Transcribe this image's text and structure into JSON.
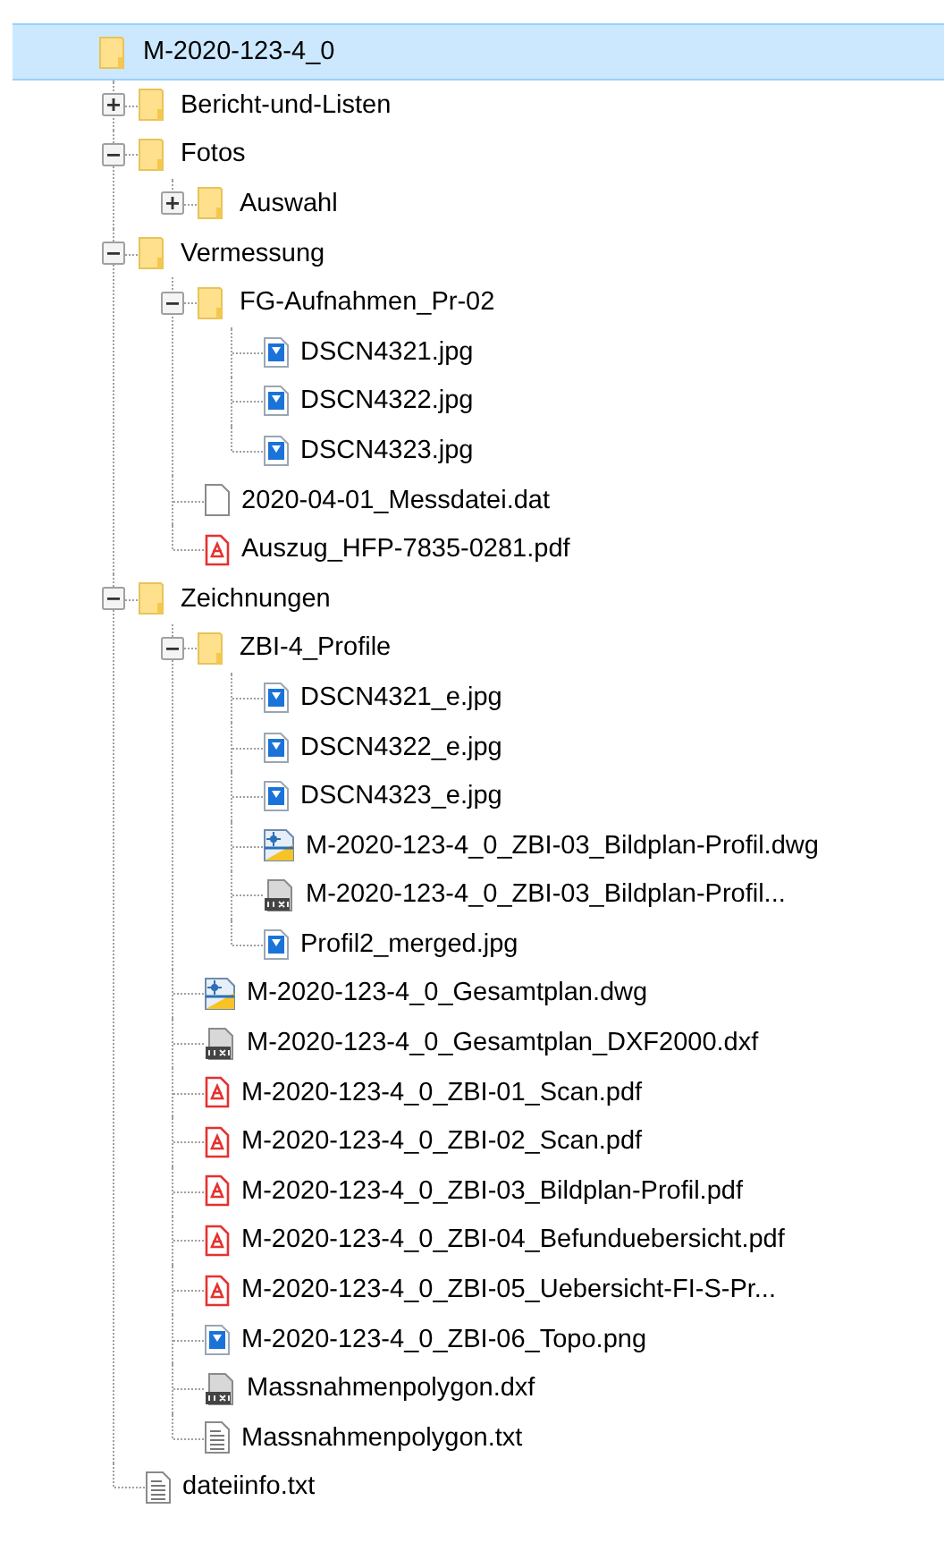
{
  "tree": {
    "name": "M-2020-123-4_0",
    "kind": "folder",
    "selected": true,
    "children": [
      {
        "name": "Bericht-und-Listen",
        "kind": "folder",
        "expanded": false,
        "selected": false
      },
      {
        "name": "Fotos",
        "kind": "folder",
        "expanded": true,
        "selected": false,
        "children": [
          {
            "name": "Auswahl",
            "kind": "folder",
            "expanded": false,
            "selected": false
          }
        ]
      },
      {
        "name": "Vermessung",
        "kind": "folder",
        "expanded": true,
        "selected": false,
        "children": [
          {
            "name": "FG-Aufnahmen_Pr-02",
            "kind": "folder",
            "expanded": true,
            "selected": false,
            "children": [
              {
                "name": "DSCN4321.jpg",
                "kind": "image",
                "selected": false
              },
              {
                "name": "DSCN4322.jpg",
                "kind": "image",
                "selected": false
              },
              {
                "name": "DSCN4323.jpg",
                "kind": "image",
                "selected": false
              }
            ]
          },
          {
            "name": "2020-04-01_Messdatei.dat",
            "kind": "blank",
            "selected": false
          },
          {
            "name": "Auszug_HFP-7835-0281.pdf",
            "kind": "pdf",
            "selected": false
          }
        ]
      },
      {
        "name": "Zeichnungen",
        "kind": "folder",
        "expanded": true,
        "selected": false,
        "children": [
          {
            "name": "ZBI-4_Profile",
            "kind": "folder",
            "expanded": true,
            "selected": false,
            "children": [
              {
                "name": "DSCN4321_e.jpg",
                "kind": "image",
                "selected": false
              },
              {
                "name": "DSCN4322_e.jpg",
                "kind": "image",
                "selected": false
              },
              {
                "name": "DSCN4323_e.jpg",
                "kind": "image",
                "selected": false
              },
              {
                "name": "M-2020-123-4_0_ZBI-03_Bildplan-Profil.dwg",
                "kind": "dwg",
                "selected": false
              },
              {
                "name": "M-2020-123-4_0_ZBI-03_Bildplan-Profil...",
                "kind": "dxf",
                "selected": false
              },
              {
                "name": "Profil2_merged.jpg",
                "kind": "image",
                "selected": false
              }
            ]
          },
          {
            "name": "M-2020-123-4_0_Gesamtplan.dwg",
            "kind": "dwg",
            "selected": false
          },
          {
            "name": "M-2020-123-4_0_Gesamtplan_DXF2000.dxf",
            "kind": "dxf",
            "selected": false
          },
          {
            "name": "M-2020-123-4_0_ZBI-01_Scan.pdf",
            "kind": "pdf",
            "selected": false
          },
          {
            "name": "M-2020-123-4_0_ZBI-02_Scan.pdf",
            "kind": "pdf",
            "selected": false
          },
          {
            "name": "M-2020-123-4_0_ZBI-03_Bildplan-Profil.pdf",
            "kind": "pdf",
            "selected": false
          },
          {
            "name": "M-2020-123-4_0_ZBI-04_Befunduebersicht.pdf",
            "kind": "pdf",
            "selected": false
          },
          {
            "name": "M-2020-123-4_0_ZBI-05_Uebersicht-FI-S-Pr...",
            "kind": "pdf",
            "selected": false
          },
          {
            "name": "M-2020-123-4_0_ZBI-06_Topo.png",
            "kind": "image",
            "selected": false
          },
          {
            "name": "Massnahmenpolygon.dxf",
            "kind": "dxf",
            "selected": false
          },
          {
            "name": "Massnahmenpolygon.txt",
            "kind": "text",
            "selected": false
          }
        ]
      },
      {
        "name": "dateiinfo.txt",
        "kind": "text",
        "selected": false
      }
    ]
  }
}
